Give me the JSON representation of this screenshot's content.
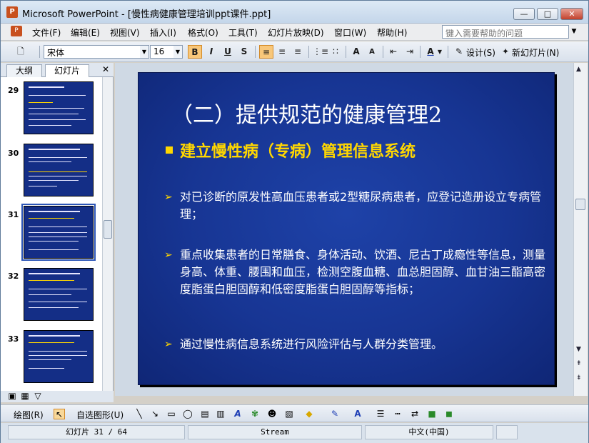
{
  "window": {
    "title": "Microsoft PowerPoint - [慢性病健康管理培训ppt课件.ppt]",
    "app_icon": "P",
    "minimize": "—",
    "maximize": "□",
    "close": "✕"
  },
  "menu": {
    "items": [
      "文件(F)",
      "编辑(E)",
      "视图(V)",
      "插入(I)",
      "格式(O)",
      "工具(T)",
      "幻灯片放映(D)",
      "窗口(W)",
      "帮助(H)"
    ],
    "help_placeholder": "键入需要帮助的问题"
  },
  "toolbar": {
    "font": "宋体",
    "size": "16",
    "bold": "B",
    "italic": "I",
    "underline": "U",
    "shadow": "S",
    "increase_font": "A",
    "decrease_font": "A",
    "font_color": "A",
    "design_label": "设计(S)",
    "new_slide_label": "新幻灯片(N)"
  },
  "left_pane": {
    "tab_outline": "大纲",
    "tab_slides": "幻灯片",
    "close": "✕",
    "thumbnails": [
      {
        "number": "29"
      },
      {
        "number": "30"
      },
      {
        "number": "31"
      },
      {
        "number": "32"
      },
      {
        "number": "33"
      }
    ]
  },
  "slide": {
    "title": "（二）提供规范的健康管理2",
    "subtitle": "建立慢性病（专病）管理信息系统",
    "bullets": [
      "对已诊断的原发性高血压患者或2型糖尿病患者，应登记造册设立专病管理；",
      "重点收集患者的日常膳食、身体活动、饮酒、尼古丁成瘾性等信息，测量身高、体重、腰围和血压，检测空腹血糖、血总胆固醇、血甘油三酯高密度脂蛋白胆固醇和低密度脂蛋白胆固醇等指标；",
      "通过慢性病信息系统进行风险评估与人群分类管理。"
    ],
    "colors": {
      "background": "#173593",
      "title": "#ffffff",
      "subtitle": "#ffd700",
      "bullet_marker": "#ffd700"
    }
  },
  "draw_toolbar": {
    "draw_label": "绘图(R)",
    "autoshapes_label": "自选图形(U)"
  },
  "status": {
    "slide_info": "幻灯片 31 / 64",
    "design": "Stream",
    "language": "中文(中国)"
  }
}
